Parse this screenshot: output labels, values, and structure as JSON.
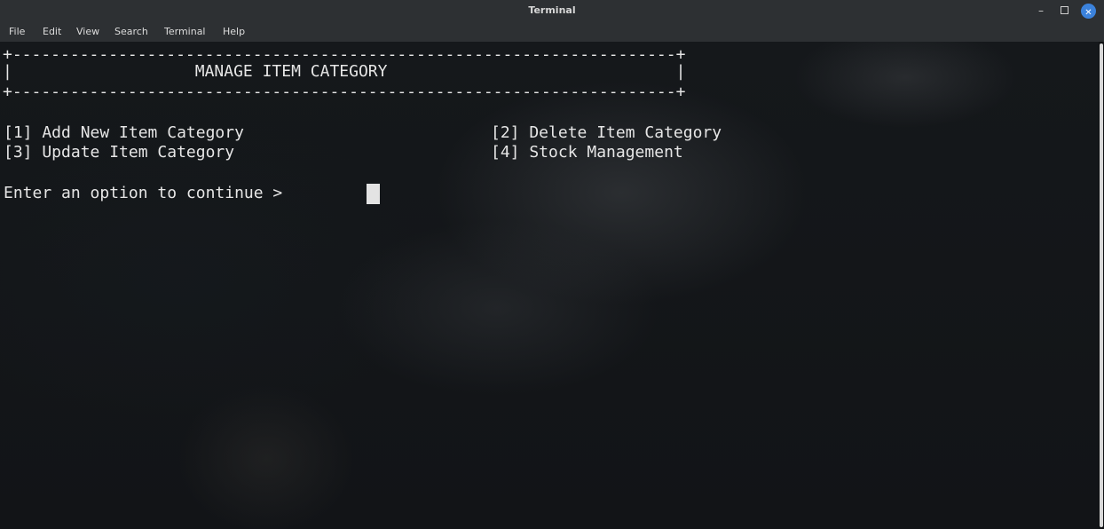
{
  "window": {
    "title": "Terminal",
    "minimize_glyph": "–",
    "close_glyph": "✕"
  },
  "menu": [
    "File",
    "Edit",
    "View",
    "Search",
    "Terminal",
    "Help"
  ],
  "terminal": {
    "border_top": "+---------------------------------------------------------------------+",
    "header_line": "|                   MANAGE ITEM CATEGORY                              |",
    "border_bottom": "+---------------------------------------------------------------------+",
    "options": [
      "[1] Add New Item Category",
      "[2] Delete Item Category",
      "[3] Update Item Category",
      "[4] Stock Management"
    ],
    "prompt": "Enter an option to continue > "
  }
}
